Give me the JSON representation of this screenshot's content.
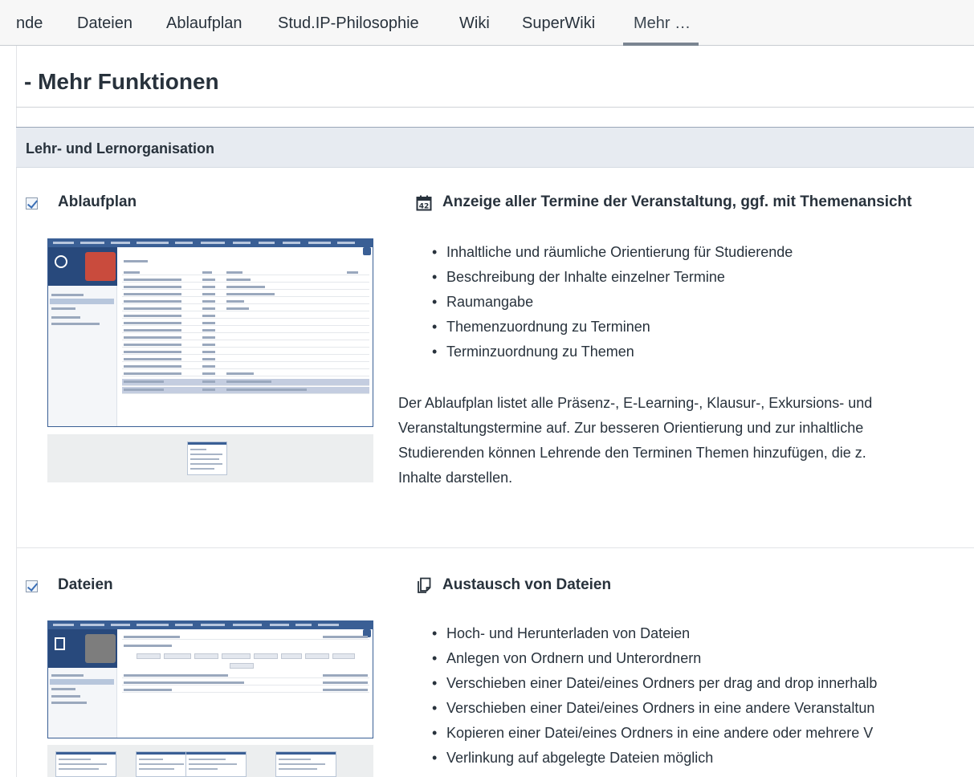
{
  "nav": {
    "tabs": [
      {
        "label": "nde"
      },
      {
        "label": "Dateien"
      },
      {
        "label": "Ablaufplan"
      },
      {
        "label": "Stud.IP-Philosophie"
      },
      {
        "label": "Wiki"
      },
      {
        "label": "SuperWiki"
      },
      {
        "label": "Mehr …",
        "active": true
      }
    ]
  },
  "page": {
    "title": "- Mehr Funktionen"
  },
  "section": {
    "title": "Lehr- und Lernorganisation"
  },
  "modules": [
    {
      "name": "Ablaufplan",
      "checked": true,
      "icon": "calendar-42-icon",
      "headline": "Anzeige aller Termine der Veranstaltung, ggf. mit Themenansicht",
      "features": [
        "Inhaltliche und räumliche Orientierung für Studierende",
        "Beschreibung der Inhalte einzelner Termine",
        "Raumangabe",
        "Themenzuordnung zu Terminen",
        "Terminzuordnung zu Themen"
      ],
      "description": [
        "Der Ablaufplan listet alle Präsenz-, E-Learning-, Klausur-, Exkursions- und",
        "Veranstaltungstermine auf. Zur besseren Orientierung und zur inhaltliche",
        "Studierenden können Lehrende den Terminen Themen hinzufügen, die z.",
        "Inhalte darstellen."
      ]
    },
    {
      "name": "Dateien",
      "checked": true,
      "icon": "files-icon",
      "headline": "Austausch von Dateien",
      "features": [
        "Hoch- und Herunterladen von Dateien",
        "Anlegen von Ordnern und Unterordnern",
        "Verschieben einer Datei/eines Ordners per drag and drop innerhalb",
        "Verschieben einer Datei/eines Ordners in eine andere Veranstaltun",
        "Kopieren einer Datei/eines Ordners in eine andere oder mehrere V",
        "Verlinkung auf abgelegte Dateien möglich"
      ]
    }
  ],
  "colors": {
    "accent": "#3a5f95",
    "section_bg": "#e7ebf1",
    "text": "#28323c"
  }
}
